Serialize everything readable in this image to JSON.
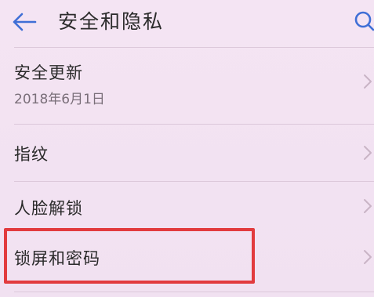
{
  "header": {
    "title": "安全和隐私",
    "back_icon": "back-arrow-icon",
    "search_icon": "search-icon",
    "accent": "#3f6fd6"
  },
  "settings": {
    "items": [
      {
        "title": "安全更新",
        "subtitle": "2018年6月1日"
      },
      {
        "title": "指纹"
      },
      {
        "title": "人脸解锁"
      },
      {
        "title": "锁屏和密码"
      }
    ]
  },
  "highlight": {
    "color": "#e23b3e"
  }
}
